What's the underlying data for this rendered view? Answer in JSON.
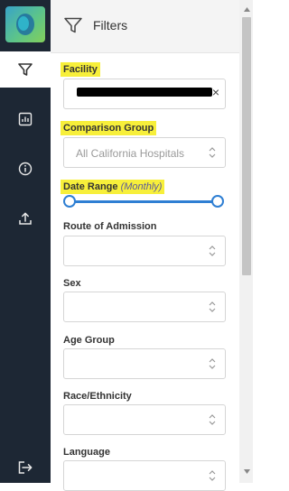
{
  "header": {
    "title": "Filters"
  },
  "sidebar": {
    "icons": [
      "logo",
      "filter-icon",
      "chart-icon",
      "info-icon",
      "upload-icon",
      "logout-icon"
    ]
  },
  "filters": {
    "facility": {
      "label": "Facility",
      "value": "",
      "clear": "×"
    },
    "comparison_group": {
      "label": "Comparison Group",
      "placeholder": "All California Hospitals"
    },
    "date_range": {
      "label": "Date Range",
      "sub_label": "(Monthly)",
      "range": [
        0,
        1
      ]
    },
    "route_of_admission": {
      "label": "Route of Admission"
    },
    "sex": {
      "label": "Sex"
    },
    "age_group": {
      "label": "Age Group"
    },
    "race_ethnicity": {
      "label": "Race/Ethnicity"
    },
    "language": {
      "label": "Language"
    }
  },
  "colors": {
    "rail": "#1d2734",
    "accent": "#2f7fd3",
    "highlight": "#f7ef3a"
  }
}
